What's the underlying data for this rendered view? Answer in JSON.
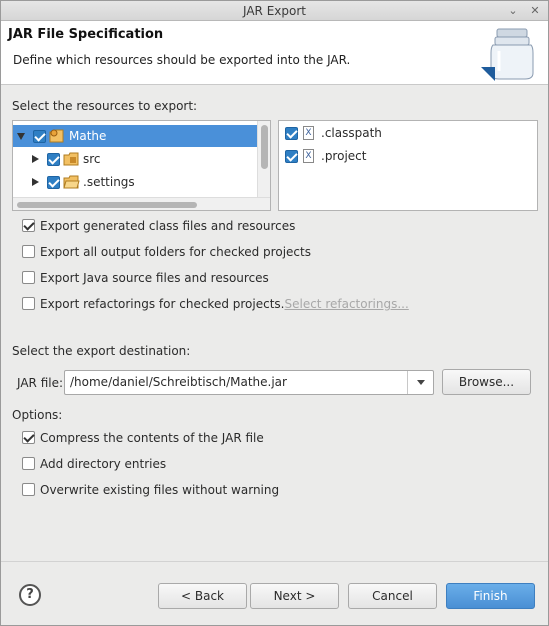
{
  "window": {
    "title": "JAR Export",
    "controls": [
      "⌄",
      "✕"
    ]
  },
  "header": {
    "title": "JAR File Specification",
    "description": "Define which resources should be exported into the JAR."
  },
  "resources": {
    "label": "Select the resources to export:",
    "tree": [
      {
        "label": "Mathe",
        "checked": true,
        "expanded": true,
        "selected": true,
        "icon": "project-folder-icon"
      },
      {
        "label": "src",
        "checked": true,
        "expanded": false,
        "icon": "package-folder-icon"
      },
      {
        "label": ".settings",
        "checked": true,
        "expanded": false,
        "icon": "folder-icon"
      }
    ],
    "files": [
      {
        "label": ".classpath",
        "checked": true,
        "icon": "xml-file-icon"
      },
      {
        "label": ".project",
        "checked": true,
        "icon": "xml-file-icon"
      }
    ]
  },
  "export_options": [
    {
      "label": "Export generated class files and resources",
      "checked": true
    },
    {
      "label": "Export all output folders for checked projects",
      "checked": false
    },
    {
      "label": "Export Java source files and resources",
      "checked": false
    },
    {
      "label": "Export refactorings for checked projects.",
      "checked": false,
      "link": "Select refactorings..."
    }
  ],
  "destination": {
    "label": "Select the export destination:",
    "jar_label": "JAR file:",
    "jar_value": "/home/daniel/Schreibtisch/Mathe.jar",
    "browse_label": "Browse..."
  },
  "options": {
    "label": "Options:",
    "items": [
      {
        "label": "Compress the contents of the JAR file",
        "checked": true
      },
      {
        "label": "Add directory entries",
        "checked": false
      },
      {
        "label": "Overwrite existing files without warning",
        "checked": false
      }
    ]
  },
  "buttons": {
    "help": "?",
    "back": "< Back",
    "next": "Next >",
    "cancel": "Cancel",
    "finish": "Finish"
  },
  "colors": {
    "accent": "#4a90d9",
    "checkbox": "#2f7fc4"
  }
}
